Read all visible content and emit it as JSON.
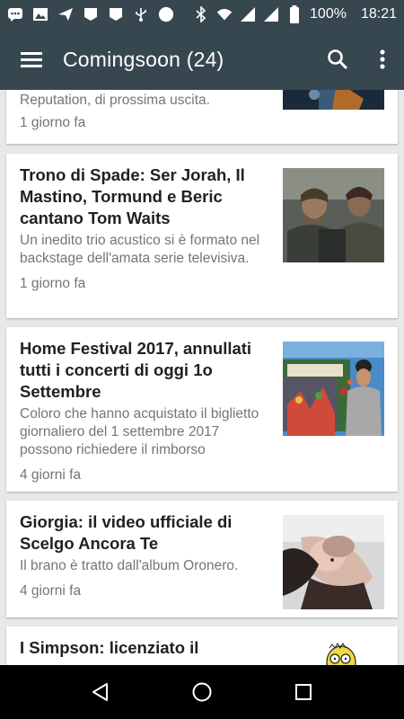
{
  "status": {
    "battery": "100%",
    "time": "18:21"
  },
  "app": {
    "title": "Comingsoon (24)"
  },
  "articles": [
    {
      "title": "",
      "desc": "Reputation, di prossima uscita.",
      "time": "1 giorno fa"
    },
    {
      "title": "Trono di Spade: Ser Jorah, Il Mastino, Tormund e Beric cantano Tom Waits",
      "desc": "Un inedito trio acustico si è formato nel backstage dell'amata serie televisiva.",
      "time": "1 giorno fa"
    },
    {
      "title": "Home Festival 2017, annullati tutti i concerti di oggi 1o Settembre",
      "desc": "Coloro che hanno acquistato il biglietto giornaliero del 1 settembre 2017 possono richiedere il rimborso",
      "time": "4 giorni fa"
    },
    {
      "title": "Giorgia: il video ufficiale di Scelgo Ancora Te",
      "desc": "Il brano è tratto dall'album Oronero.",
      "time": "4 giorni fa"
    },
    {
      "title": "I Simpson: licenziato il",
      "desc": "",
      "time": ""
    }
  ],
  "icons": {
    "menu": "hamburger-menu-icon",
    "search": "search-icon",
    "more": "more-vert-icon",
    "back": "back-triangle-icon",
    "home": "home-circle-icon",
    "recents": "recents-square-icon"
  }
}
